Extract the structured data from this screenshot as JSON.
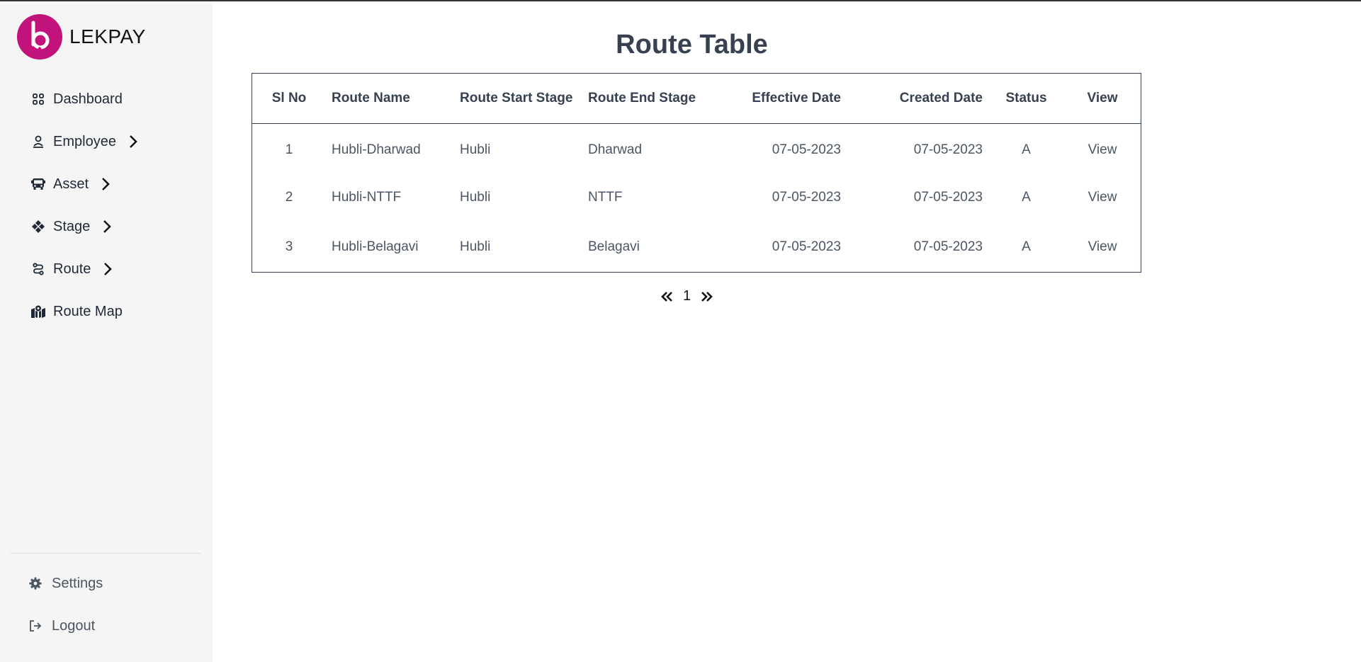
{
  "brand": {
    "name": "LEKPAY",
    "logo_letter": "b",
    "color": "#c2137d"
  },
  "sidebar": {
    "items": [
      {
        "label": "Dashboard",
        "icon": "grid-icon",
        "has_submenu": false
      },
      {
        "label": "Employee",
        "icon": "user-icon",
        "has_submenu": true
      },
      {
        "label": "Asset",
        "icon": "bus-icon",
        "has_submenu": true
      },
      {
        "label": "Stage",
        "icon": "diamond-grid-icon",
        "has_submenu": true
      },
      {
        "label": "Route",
        "icon": "route-icon",
        "has_submenu": true
      },
      {
        "label": "Route Map",
        "icon": "map-pin-icon",
        "has_submenu": false
      }
    ],
    "bottom": [
      {
        "label": "Settings",
        "icon": "gear-icon"
      },
      {
        "label": "Logout",
        "icon": "logout-icon"
      }
    ]
  },
  "main": {
    "title": "Route Table",
    "table": {
      "columns": [
        "Sl No",
        "Route Name",
        "Route Start Stage",
        "Route End Stage",
        "Effective Date",
        "Created Date",
        "Status",
        "View"
      ],
      "rows": [
        [
          "1",
          "Hubli-Dharwad",
          "Hubli",
          "Dharwad",
          "07-05-2023",
          "07-05-2023",
          "A",
          "View"
        ],
        [
          "2",
          "Hubli-NTTF",
          "Hubli",
          "NTTF",
          "07-05-2023",
          "07-05-2023",
          "A",
          "View"
        ],
        [
          "3",
          "Hubli-Belagavi",
          "Hubli",
          "Belagavi",
          "07-05-2023",
          "07-05-2023",
          "A",
          "View"
        ]
      ]
    },
    "pagination": {
      "current_page": "1"
    }
  }
}
